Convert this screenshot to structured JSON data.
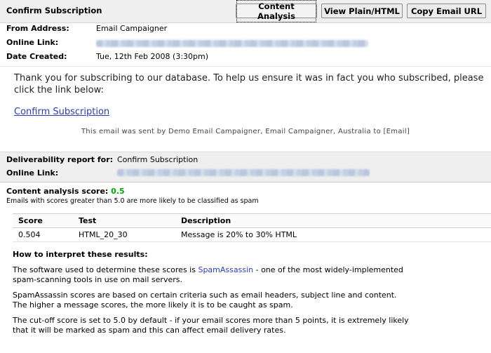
{
  "header": {
    "title": "Confirm Subscription",
    "buttons": {
      "content_analysis": "Content Analysis",
      "view_plain_html": "View Plain/HTML",
      "copy_email_url": "Copy Email URL"
    }
  },
  "meta": {
    "from_label": "From Address:",
    "from_value": "Email Campaigner",
    "online_label": "Online Link:",
    "date_label": "Date Created:",
    "date_value": "Tue, 12th Feb 2008 (3:30pm)"
  },
  "message": {
    "body": "Thank you for subscribing to our database.  To help us ensure it was in fact you who subscribed, please click the link below:",
    "link_text": "Confirm Subscription",
    "footer": "This email was sent by Demo Email Campaigner, Email Campaigner, Australia to [Email]"
  },
  "deliverability": {
    "report_label": "Deliverability report for:",
    "report_value": "Confirm Subscription",
    "online_label": "Online Link:"
  },
  "analysis": {
    "score_label": "Content analysis score:",
    "score_value": "0.5",
    "note": "Emails with scores greater than 5.0 are more likely to be classified as spam",
    "columns": [
      "Score",
      "Test",
      "Description"
    ],
    "rows": [
      {
        "score": "0.504",
        "test": "HTML_20_30",
        "description": "Message is 20% to 30% HTML"
      }
    ],
    "howto_title": "How to interpret these results:",
    "para1_before": "The software used to determine these scores is ",
    "para1_link": "SpamAssassin",
    "para1_after": " - one of the most widely-implemented spam-scanning tools in use on mail servers.",
    "para2": "SpamAssassin scores are based on certain criteria such as email headers, subject line and content. The higher a message scores, the more likely it is to be caught as spam.",
    "para3": "The cut-off score is set to 5.0 by default - if your email scores more than 5 points, it is extremely likely that it will be marked as spam and this can affect email delivery rates."
  },
  "colors": {
    "score_good": "#00aa00",
    "link": "#2a3cb8",
    "panel": "#efefef"
  }
}
